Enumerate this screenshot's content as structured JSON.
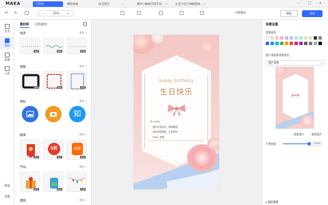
{
  "app": {
    "logo": "MAKA",
    "tabs": [
      {
        "label": "工作台",
        "active": true
      },
      {
        "label": "模板商城"
      },
      {
        "label": "作品首页"
      },
      {
        "label": "撸字小破帐页如手动..."
      },
      {
        "label": "礼品卡生日海报图海..."
      }
    ],
    "window_controls": "– □ ×"
  },
  "toolbar": {
    "undo": "↶",
    "redo": "↷",
    "zoom_minus": "−",
    "zoom_value": "65%",
    "zoom_plus": "+",
    "publish_label": "付费素材",
    "save_label": "保存",
    "export_label": "导出"
  },
  "leftnav": {
    "items": [
      {
        "label": "文字"
      },
      {
        "label": "素材",
        "active": true
      },
      {
        "label": "背景"
      },
      {
        "label": "上传"
      }
    ],
    "bottom": [
      {
        "label": "帮助"
      },
      {
        "label": "设置"
      }
    ]
  },
  "panel": {
    "tabs": [
      {
        "label": "素材库",
        "active": true
      },
      {
        "label": "已购素材"
      }
    ],
    "sections": [
      {
        "title": "线条",
        "more": "更多 >"
      },
      {
        "title": "相框",
        "more": "更多 >"
      },
      {
        "title": "图标",
        "more": "更多 >"
      },
      {
        "title": "徽章",
        "more": "更多 >"
      },
      {
        "title": "节日",
        "more": "更多 >"
      },
      {
        "title": "爆款",
        "more": "更多 >"
      }
    ],
    "badge": "免费",
    "badge_vip": "会员",
    "icon_letter": "知",
    "sale_text": "5折",
    "sale_text2": "川万"
  },
  "poster": {
    "subtitle": "happy birthday",
    "title": "生日快乐",
    "message": [
      "To: maka",
      "愿你平安喜乐，事事顺意！",
      "永远年轻漂亮，生日快乐！",
      "From: 悦悦"
    ]
  },
  "rpanel": {
    "title": "背景设置",
    "bg_color_label": "背景颜色",
    "bg_image_label": "图片或图案背景填充",
    "select_value": "图片背景",
    "replace_link": "更换图片",
    "delete_link": "删除图片",
    "opacity_label": "不透明度",
    "opacity_value": "100%",
    "layer_label": "图层管理",
    "swatches": [
      "#ffffff",
      "#f4d8d0",
      "#f4c7c7",
      "#e8b6d6",
      "#c8b6e8",
      "#b6c8e8",
      "#b6e0e8",
      "#b6e8c8",
      "#d8e8b6",
      "#e8e0b6",
      "#333333",
      "#888888",
      "#2f6bff",
      "#1e90ff",
      "#00bcd4",
      "#4caf50",
      "#ff9800",
      "#f44336",
      "#e91e63",
      "#9c27b0",
      "#795548",
      "#607d8b",
      "#aaaaaa",
      "#000000"
    ]
  }
}
